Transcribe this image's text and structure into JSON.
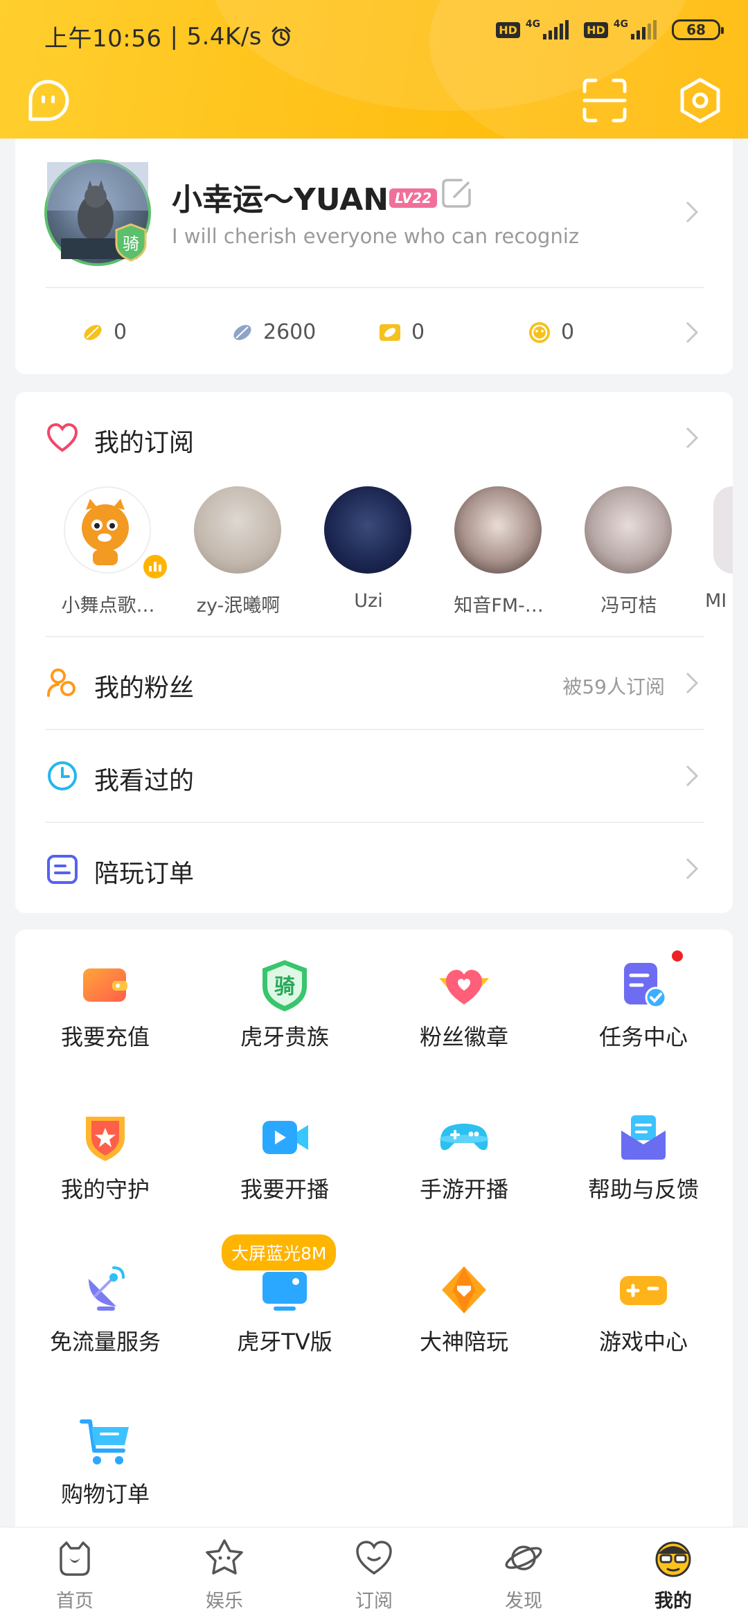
{
  "status_bar": {
    "time": "上午10:56",
    "speed": "5.4K/s",
    "hd1": "HD",
    "net1": "4G",
    "hd2": "HD",
    "net2": "4G",
    "battery": "68"
  },
  "colors": {
    "brand": "#ffc21a",
    "accent_green": "#5bbf6c",
    "badge_pink": "#f0709a",
    "red_dot": "#ee2222",
    "promo": "#ffb400"
  },
  "header": {
    "left_icon": "chat-bubble-icon",
    "scan_icon": "scan-icon",
    "settings_icon": "settings-icon"
  },
  "profile": {
    "nickname": "小幸运～YUAN",
    "level": "LV22",
    "avatar_badge": "骑",
    "signature": "I will cherish everyone who can recogniz",
    "stats": [
      {
        "icon": "gold-bean-icon",
        "value": "0"
      },
      {
        "icon": "silver-bean-icon",
        "value": "2600"
      },
      {
        "icon": "ticket-icon",
        "value": "0"
      },
      {
        "icon": "coin-icon",
        "value": "0"
      }
    ]
  },
  "subscriptions": {
    "title": "我的订阅",
    "items": [
      {
        "name": "小舞点歌…"
      },
      {
        "name": "zy-泯曦啊"
      },
      {
        "name": "Uzi"
      },
      {
        "name": "知音FM-…"
      },
      {
        "name": "冯可桔"
      },
      {
        "name": "MI"
      }
    ]
  },
  "rows": {
    "fans": {
      "label": "我的粉丝",
      "right": "被59人订阅"
    },
    "history": {
      "label": "我看过的"
    },
    "orders": {
      "label": "陪玩订单"
    }
  },
  "grid": {
    "items": [
      {
        "label": "我要充值",
        "icon": "wallet-icon"
      },
      {
        "label": "虎牙贵族",
        "icon": "noble-shield-icon",
        "glyph": "骑"
      },
      {
        "label": "粉丝徽章",
        "icon": "fan-badge-icon"
      },
      {
        "label": "任务中心",
        "icon": "task-icon"
      },
      {
        "label": "我的守护",
        "icon": "guard-icon"
      },
      {
        "label": "我要开播",
        "icon": "camera-icon"
      },
      {
        "label": "手游开播",
        "icon": "gamepad-live-icon"
      },
      {
        "label": "帮助与反馈",
        "icon": "help-mail-icon"
      },
      {
        "label": "免流量服务",
        "icon": "satellite-icon"
      },
      {
        "label": "虎牙TV版",
        "icon": "tv-icon"
      },
      {
        "label": "大神陪玩",
        "icon": "diamond-icon"
      },
      {
        "label": "游戏中心",
        "icon": "game-center-icon"
      },
      {
        "label": "购物订单",
        "icon": "cart-icon"
      }
    ],
    "promo": "大屏蓝光8M"
  },
  "tabs": [
    {
      "label": "首页",
      "icon": "home-icon"
    },
    {
      "label": "娱乐",
      "icon": "star-face-icon"
    },
    {
      "label": "订阅",
      "icon": "heart-icon"
    },
    {
      "label": "发现",
      "icon": "planet-icon"
    },
    {
      "label": "我的",
      "icon": "profile-face-icon",
      "active": true
    }
  ]
}
